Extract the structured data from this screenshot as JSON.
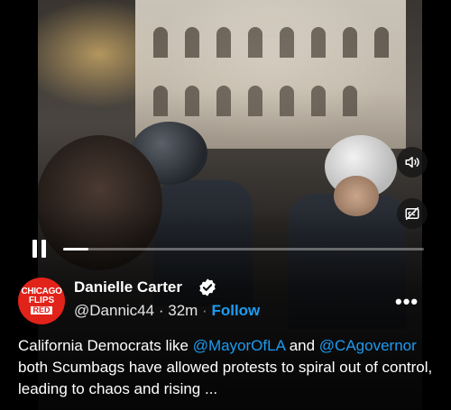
{
  "video": {
    "progress_fraction": 0.07
  },
  "author": {
    "avatar_text": {
      "line1": "CHICAGO",
      "line2": "FLIPS",
      "line3": "RED"
    },
    "display_name": "Danielle Carter",
    "handle": "@Dannic44",
    "separator": "·",
    "time": "32m",
    "follow_label": "Follow",
    "verified": true
  },
  "tweet": {
    "part1": "California Democrats like ",
    "mention1": "@MayorOfLA",
    "part2": " and ",
    "mention2": "@CAgovernor",
    "part3": " both Scumbags have allowed protests to spiral out of control, leading to chaos and rising ..."
  },
  "colors": {
    "accent": "#1d9bf0",
    "avatar_bg": "#e2231a"
  },
  "icons": [
    "pause-icon",
    "volume-icon",
    "captions-icon",
    "verified-badge-icon",
    "more-options-icon"
  ]
}
